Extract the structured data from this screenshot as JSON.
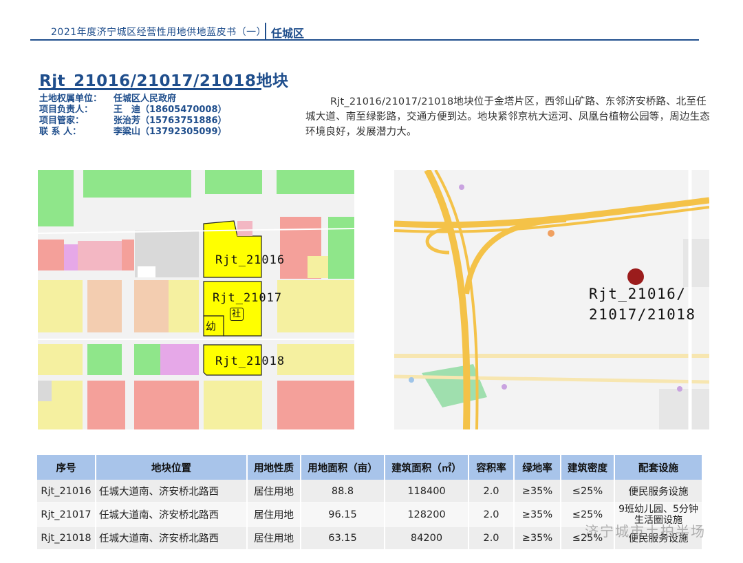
{
  "header": {
    "title": "2021年度济宁城区经营性用地供地蓝皮书（一）",
    "district": "任城区"
  },
  "block_title": "Rjt_21016/21017/21018地块",
  "info": [
    {
      "label": "土地权属单位：",
      "value": "任城区人民政府"
    },
    {
      "label": "项目负责人：",
      "value": "王　迪（18605470008）"
    },
    {
      "label": "项目管家：",
      "value": "张治芳（15763751886）"
    },
    {
      "label": "联 系 人：",
      "value": "李粱山（13792305099）"
    }
  ],
  "description": "Rjt_21016/21017/21018地块位于金塔片区，西邻山矿路、东邻济安桥路、北至任城大道、南至绿影路，交通方便到达。地块紧邻京杭大运河、凤凰台植物公园等，周边生态环境良好，发展潜力大。",
  "plan_map": {
    "plots": [
      "Rjt_21016",
      "Rjt_21017",
      "Rjt_21018"
    ],
    "kindergarten": "幼",
    "community": "社"
  },
  "location_map": {
    "label_line1": "Rjt_21016/",
    "label_line2": "21017/21018",
    "marker_color": "#9b1c1c"
  },
  "table": {
    "headers": [
      "序号",
      "地块位置",
      "用地性质",
      "用地面积（亩）",
      "建筑面积（㎡）",
      "容积率",
      "绿地率",
      "建筑密度",
      "配套设施"
    ],
    "rows": [
      [
        "Rjt_21016",
        "任城大道南、济安桥北路西",
        "居住用地",
        "88.8",
        "118400",
        "2.0",
        "≥35%",
        "≤25%",
        "便民服务设施"
      ],
      [
        "Rjt_21017",
        "任城大道南、济安桥北路西",
        "居住用地",
        "96.15",
        "128200",
        "2.0",
        "≥35%",
        "≤25%",
        "9班幼儿园、5分钟生活圈设施"
      ],
      [
        "Rjt_21018",
        "任城大道南、济安桥北路西",
        "居住用地",
        "63.15",
        "84200",
        "2.0",
        "≥35%",
        "≤25%",
        "便民服务设施"
      ]
    ]
  },
  "watermark": "济宁城市土拍半场",
  "colors": {
    "brand_blue": "#1f4e8c",
    "table_header": "#a8c4ea",
    "residential": "#f5f0a0",
    "plot_highlight": "#ffff00",
    "green_space": "#8fe68a",
    "commercial": "#f4a09a"
  }
}
